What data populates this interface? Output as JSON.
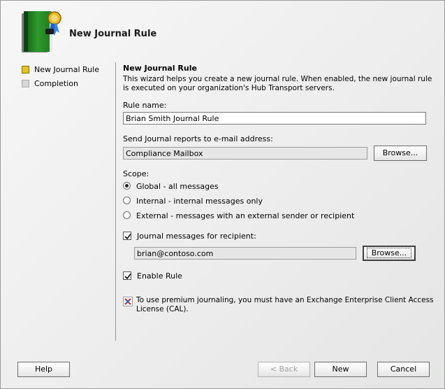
{
  "window": {
    "title": "New Journal Rule"
  },
  "nav": {
    "items": [
      {
        "label": "New Journal Rule",
        "active": true
      },
      {
        "label": "Completion",
        "active": false
      }
    ]
  },
  "form": {
    "section_title": "New Journal Rule",
    "description": "This wizard helps you create a new journal rule. When enabled, the new journal rule is executed on your organization's Hub Transport servers.",
    "rule_name_label": "Rule name:",
    "rule_name_value": "Brian Smith Journal Rule",
    "send_to_label": "Send Journal reports to e-mail address:",
    "send_to_value": "Compliance Mailbox",
    "browse_label": "Browse...",
    "scope_label": "Scope:",
    "scope_options": [
      {
        "label": "Global - all messages",
        "selected": true
      },
      {
        "label": "Internal - internal messages only",
        "selected": false
      },
      {
        "label": "External - messages with an external sender or recipient",
        "selected": false
      }
    ],
    "journal_recipient_label": "Journal messages for recipient:",
    "journal_recipient_checked": true,
    "recipient_value": "brian@contoso.com",
    "recipient_browse_label": "Browse...",
    "enable_rule_label": "Enable Rule",
    "enable_rule_checked": true,
    "premium_notice": "To use premium journaling, you must have an Exchange Enterprise Client Access License (CAL)."
  },
  "footer": {
    "help_label": "Help",
    "back_label": "< Back",
    "new_label": "New",
    "cancel_label": "Cancel"
  },
  "colors": {
    "accent": "#e3c126",
    "divider": "#8e9aa8"
  }
}
